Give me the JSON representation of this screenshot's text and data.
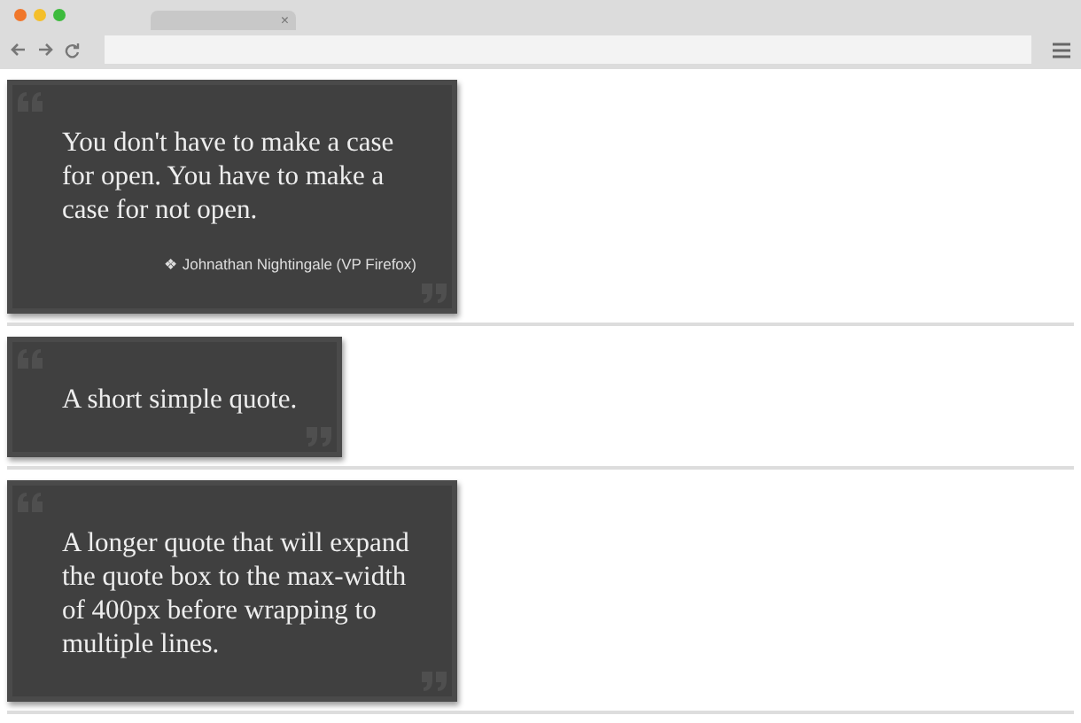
{
  "browser": {
    "tab_close": "×"
  },
  "quotes": [
    {
      "text": "You don't have to make a case for open. You have to make a case for not open.",
      "attribution": "❖ Johnathan Nightingale (VP Firefox)"
    },
    {
      "text": "A short simple quote."
    },
    {
      "text": "A longer quote that will expand the quote box to the max-width of 400px before wrapping to multiple lines."
    }
  ]
}
